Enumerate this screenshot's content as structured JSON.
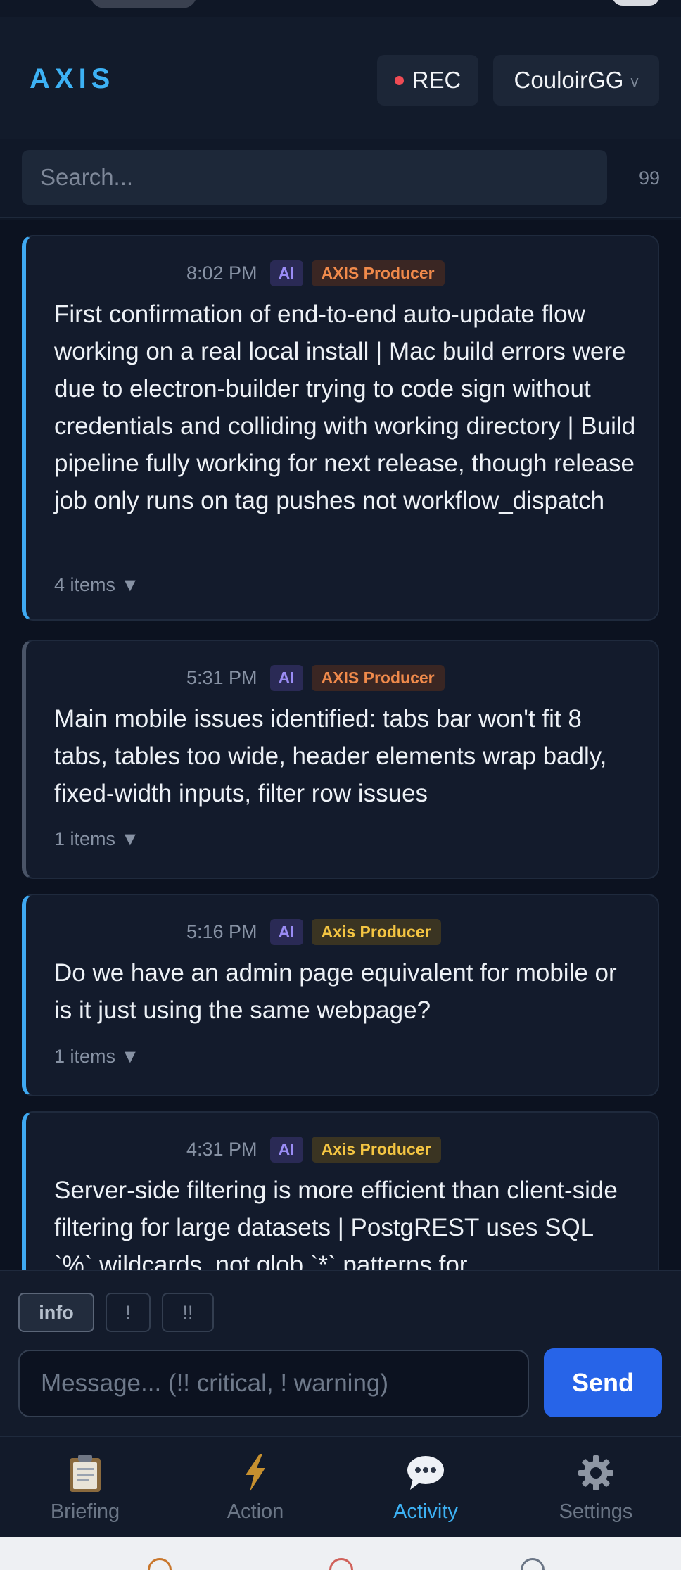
{
  "app": {
    "brand": "AXIS"
  },
  "header": {
    "rec_label": "REC",
    "org_label": "CouloirGG",
    "org_chevron": "v"
  },
  "search": {
    "placeholder": "Search...",
    "count": "99"
  },
  "feed": {
    "cards": [
      {
        "time": "8:02 PM",
        "ai_badge": "AI",
        "source": "AXIS Producer",
        "text": "First confirmation of end-to-end auto-update flow working on a real local install | Mac build errors were due to electron-builder trying to code sign without credentials and colliding with working directory | Build pipeline fully working for next release, though release job only runs on tag pushes not workflow_dispatch",
        "items": "4 items ▼"
      },
      {
        "time": "5:31 PM",
        "ai_badge": "AI",
        "source": "AXIS Producer",
        "text": "Main mobile issues identified: tabs bar won't fit 8 tabs, tables too wide, header elements wrap badly, fixed-width inputs, filter row issues",
        "items": "1 items ▼"
      },
      {
        "time": "5:16 PM",
        "ai_badge": "AI",
        "source": "Axis Producer",
        "text": "Do we have an admin page equivalent for mobile or is it just using the same webpage?",
        "items": "1 items ▼"
      },
      {
        "time": "4:31 PM",
        "ai_badge": "AI",
        "source": "Axis Producer",
        "text": "Server-side filtering is more efficient than client-side filtering for large datasets | PostgREST uses SQL `%` wildcards, not glob `*` patterns for"
      }
    ]
  },
  "composer": {
    "severity": [
      "info",
      "!",
      "!!"
    ],
    "placeholder": "Message... (!! critical, ! warning)",
    "send_label": "Send"
  },
  "nav": {
    "items": [
      {
        "label": "Briefing",
        "icon": "clipboard-icon"
      },
      {
        "label": "Action",
        "icon": "lightning-icon"
      },
      {
        "label": "Activity",
        "icon": "speech-bubble-icon",
        "active": true
      },
      {
        "label": "Settings",
        "icon": "gear-icon"
      }
    ]
  },
  "colors": {
    "accent": "#3db2f5",
    "send": "#2764e8",
    "rec_dot": "#ef4b54",
    "source_orange": "#f08a4b",
    "source_yellow": "#f4c542",
    "ai_badge": "#9a8cf5"
  }
}
